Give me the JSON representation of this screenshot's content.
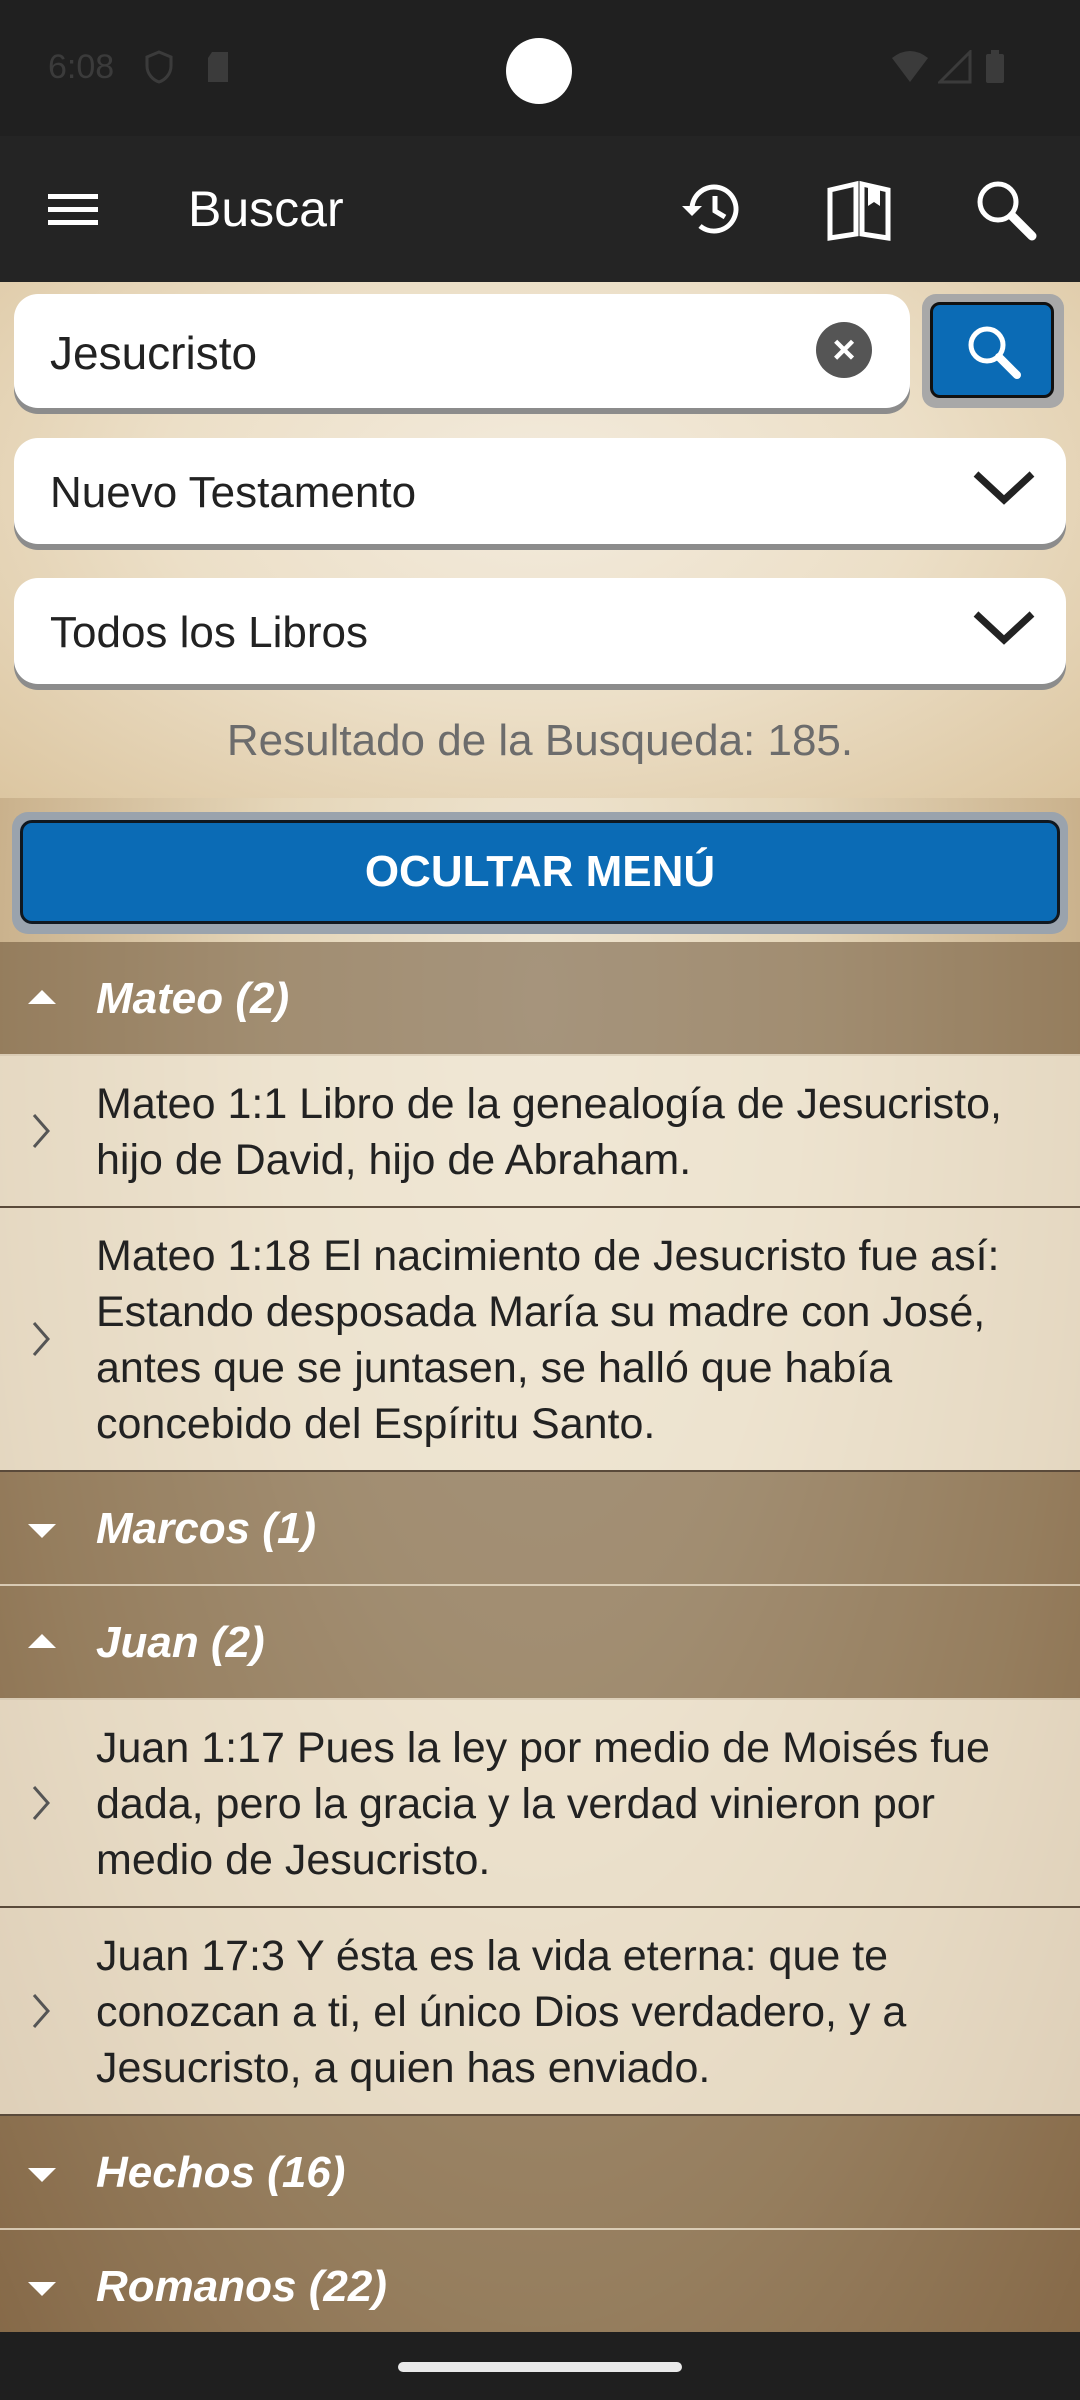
{
  "status_bar": {
    "time": "6:08"
  },
  "app_bar": {
    "title": "Buscar"
  },
  "search": {
    "query": "Jesucristo",
    "testament": "Nuevo Testamento",
    "books": "Todos los Libros",
    "result_count": "Resultado de la Busqueda: 185."
  },
  "hide_menu_label": "OCULTAR MENÚ",
  "groups": [
    {
      "label": "Mateo (2)",
      "expanded": true
    },
    {
      "label": "Marcos (1)",
      "expanded": false
    },
    {
      "label": "Juan (2)",
      "expanded": true
    },
    {
      "label": "Hechos (16)",
      "expanded": false
    },
    {
      "label": "Romanos (22)",
      "expanded": false
    }
  ],
  "verses": {
    "mateo_1": "Mateo 1:1 Libro de la genealogía de Jesucristo, hijo de David, hijo de Abraham.",
    "mateo_2": "Mateo 1:18 El nacimiento de Jesucristo fue así: Estando desposada María su madre con José, antes que se juntasen, se halló que había concebido del Espíritu Santo.",
    "juan_1": "Juan 1:17 Pues la ley por medio de Moisés fue dada, pero la gracia y la verdad vinieron por medio de Jesucristo.",
    "juan_2": "Juan 17:3 Y ésta es la vida eterna: que te conozcan a ti, el único Dios verdadero, y a Jesucristo, a quien has enviado."
  },
  "colors": {
    "accent": "#0b6bb5",
    "app_bar": "#242424"
  }
}
